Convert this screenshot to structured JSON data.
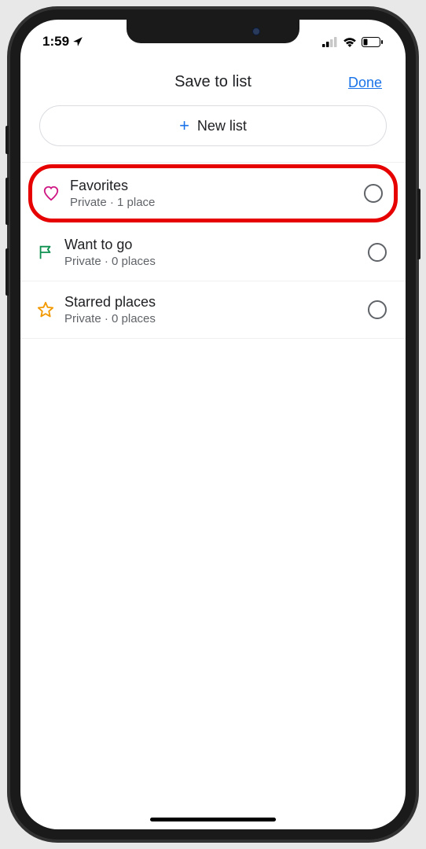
{
  "status": {
    "time": "1:59"
  },
  "header": {
    "title": "Save to list",
    "done_label": "Done"
  },
  "new_list": {
    "label": "New list"
  },
  "lists": [
    {
      "title": "Favorites",
      "subtitle": "Private · 1 place",
      "icon": "heart",
      "highlighted": true
    },
    {
      "title": "Want to go",
      "subtitle": "Private · 0 places",
      "icon": "flag",
      "highlighted": false
    },
    {
      "title": "Starred places",
      "subtitle": "Private · 0 places",
      "icon": "star",
      "highlighted": false
    }
  ]
}
